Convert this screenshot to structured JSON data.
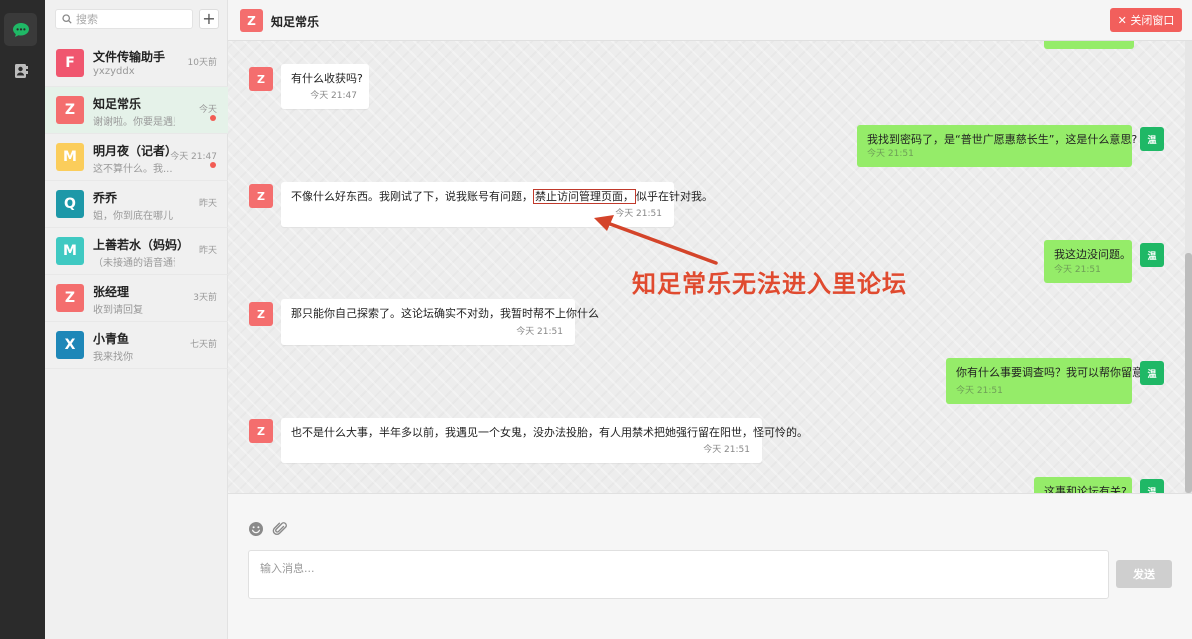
{
  "rail": {
    "items": [
      {
        "name": "chat",
        "icon": "chat-bubble-icon",
        "active": true
      },
      {
        "name": "contacts",
        "icon": "address-book-icon",
        "active": false
      }
    ]
  },
  "search": {
    "placeholder": "搜索",
    "add_label": "+"
  },
  "contacts": [
    {
      "initial": "F",
      "name": "文件传输助手",
      "preview": "yxzyddx",
      "time": "10天前",
      "color": "#f0566f",
      "unread": false,
      "active": false
    },
    {
      "initial": "Z",
      "name": "知足常乐",
      "preview": "谢谢啦。你要是遇见什...",
      "time": "今天",
      "color": "#f46e6e",
      "unread": true,
      "active": true
    },
    {
      "initial": "M",
      "name": "明月夜（记者）",
      "preview": "这不算什么。我...",
      "time": "今天 21:47",
      "color": "#fbcd5b",
      "unread": true,
      "active": false
    },
    {
      "initial": "Q",
      "name": "乔乔",
      "preview": "姐，你到底在哪儿",
      "time": "昨天",
      "color": "#1d98a8",
      "unread": false,
      "active": false
    },
    {
      "initial": "M",
      "name": "上善若水（妈妈）",
      "preview": "（未接通的语音通话）",
      "time": "昨天",
      "color": "#3fc9c2",
      "unread": false,
      "active": false
    },
    {
      "initial": "Z",
      "name": "张经理",
      "preview": "收到请回复",
      "time": "3天前",
      "color": "#f46e6e",
      "unread": false,
      "active": false
    },
    {
      "initial": "X",
      "name": "小青鱼",
      "preview": "我来找你",
      "time": "七天前",
      "color": "#1e87b8",
      "unread": false,
      "active": false
    }
  ],
  "header": {
    "initial": "Z",
    "title": "知足常乐",
    "close_label": "✕ 关闭窗口"
  },
  "messages": [
    {
      "side": "in",
      "initial": "Z",
      "text": "有什么收获吗?",
      "time": "今天 21:47"
    },
    {
      "side": "out",
      "initial": "温",
      "text": "我找到密码了，是“普世广愿惠慈长生”，这是什么意思?",
      "time": "今天 21:51"
    },
    {
      "side": "in",
      "initial": "Z",
      "text_before": "不像什么好东西。我刚试了下，说我账号有问题，",
      "text_highlight": "禁止访问管理页面，",
      "text_after": "似乎在针对我。",
      "time": "今天 21:51"
    },
    {
      "side": "out",
      "initial": "温",
      "text": "我这边没问题。",
      "time": "今天 21:51"
    },
    {
      "side": "in",
      "initial": "Z",
      "text": "那只能你自己探索了。这论坛确实不对劲，我暂时帮不上你什么",
      "time": "今天 21:51"
    },
    {
      "side": "out",
      "initial": "温",
      "text": "你有什么事要调查吗？我可以帮你留意",
      "time": "今天 21:51"
    },
    {
      "side": "in",
      "initial": "Z",
      "text": "也不是什么大事，半年多以前，我遇见一个女鬼，没办法投胎，有人用禁术把她强行留在阳世，怪可怜的。",
      "time": "今天 21:51"
    },
    {
      "side": "out",
      "initial": "温",
      "text": "这事和论坛有关?",
      "time": ""
    }
  ],
  "annotation": {
    "text": "知足常乐无法进入里论坛",
    "color": "#e04a2f"
  },
  "composer": {
    "placeholder": "输入消息...",
    "send_label": "发送",
    "tools": [
      "emoji-icon",
      "paperclip-icon"
    ]
  }
}
